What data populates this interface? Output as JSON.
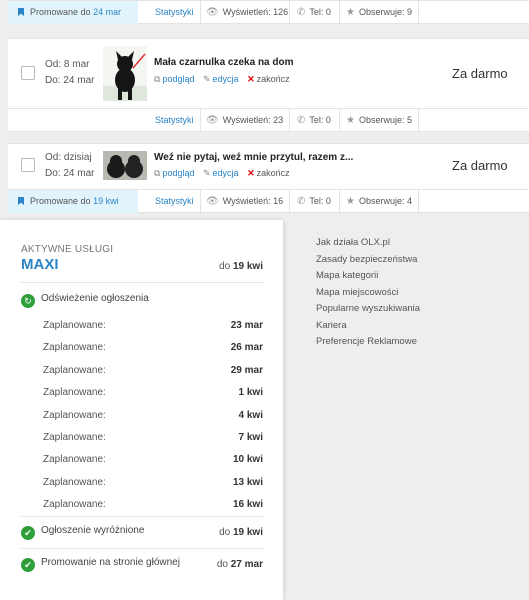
{
  "bars": [
    {
      "promo_prefix": "Promowane do",
      "promo_date": "24 mar",
      "stats": "Statystyki",
      "views": "Wyświetleń: 126",
      "phone": "Tel: 0",
      "watch": "Obserwuje: 9"
    },
    {
      "promo_prefix": "",
      "promo_date": "",
      "stats": "Statystyki",
      "views": "Wyświetleń: 23",
      "phone": "Tel: 0",
      "watch": "Obserwuje: 5"
    },
    {
      "promo_prefix": "Promowane do",
      "promo_date": "19 kwi",
      "stats": "Statystyki",
      "views": "Wyświetleń: 16",
      "phone": "Tel: 0",
      "watch": "Obserwuje: 4"
    }
  ],
  "ads": [
    {
      "from": "Od: 8 mar",
      "to": "Do: 24 mar",
      "title": "Mała czarnulka czeka na dom",
      "preview": "podgląd",
      "edit": "edycja",
      "end": "zakończ",
      "price": "Za darmo"
    },
    {
      "from": "Od: dzisiaj",
      "to": "Do: 24 mar",
      "title": "Weź nie pytaj, weź mnie przytul, razem z...",
      "preview": "podgląd",
      "edit": "edycja",
      "end": "zakończ",
      "price": "Za darmo"
    }
  ],
  "popup": {
    "label": "AKTYWNE USŁUGI",
    "package": "MAXI",
    "package_until_prefix": "do",
    "package_until": "19 kwi",
    "refresh_title": "Odświeżenie ogłoszenia",
    "schedule_label": "Zaplanowane:",
    "schedule": [
      "23 mar",
      "26 mar",
      "29 mar",
      "1 kwi",
      "4 kwi",
      "7 kwi",
      "10 kwi",
      "13 kwi",
      "16 kwi"
    ],
    "featured": "Ogłoszenie wyróżnione",
    "featured_until": "19 kwi",
    "homepage": "Promowanie na stronie głównej",
    "homepage_until": "27 mar",
    "until_prefix": "do"
  },
  "footer_links": [
    "Jak działa OLX.pl",
    "Zasady bezpieczeństwa",
    "Mapa kategorii",
    "Mapa miejscowości",
    "Popularne wyszukiwania",
    "Kariera",
    "Preferencje Reklamowe"
  ]
}
